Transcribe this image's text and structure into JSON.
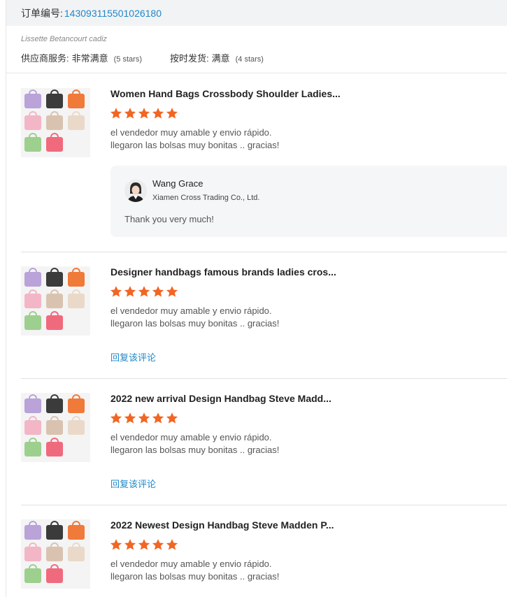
{
  "order": {
    "label": "订单编号:",
    "number": "143093115501026180"
  },
  "buyer": {
    "name": "Lissette Betancourt cadiz",
    "supplier_service_label": "供应商服务:",
    "supplier_service_value": "非常满意",
    "supplier_service_stars": "(5 stars)",
    "delivery_label": "按时发货:",
    "delivery_value": "满意",
    "delivery_stars": "(4 stars)"
  },
  "colors": {
    "star": "#f26522",
    "link": "#1f88c9"
  },
  "reviews": [
    {
      "title": "Women Hand Bags Crossbody Shoulder Ladies...",
      "rating": 5,
      "comment_line1": "el vendedor muy amable y envio rápido.",
      "comment_line2": "llegaron las bolsas muy bonitas .. gracias!",
      "reply": {
        "seller_name": "Wang Grace",
        "company": "Xiamen Cross Trading Co., Ltd.",
        "text": "Thank you very much!"
      }
    },
    {
      "title": "Designer handbags famous brands ladies cros...",
      "rating": 5,
      "comment_line1": "el vendedor muy amable y envio rápido.",
      "comment_line2": "llegaron las bolsas muy bonitas .. gracias!",
      "reply_link": "回复该评论"
    },
    {
      "title": "2022 new arrival Design Handbag Steve Madd...",
      "rating": 5,
      "comment_line1": "el vendedor muy amable y envio rápido.",
      "comment_line2": "llegaron las bolsas muy bonitas .. gracias!",
      "reply_link": "回复该评论"
    },
    {
      "title": "2022 Newest Design Handbag Steve Madden P...",
      "rating": 5,
      "comment_line1": "el vendedor muy amable y envio rápido.",
      "comment_line2": "llegaron las bolsas muy bonitas .. gracias!"
    }
  ]
}
